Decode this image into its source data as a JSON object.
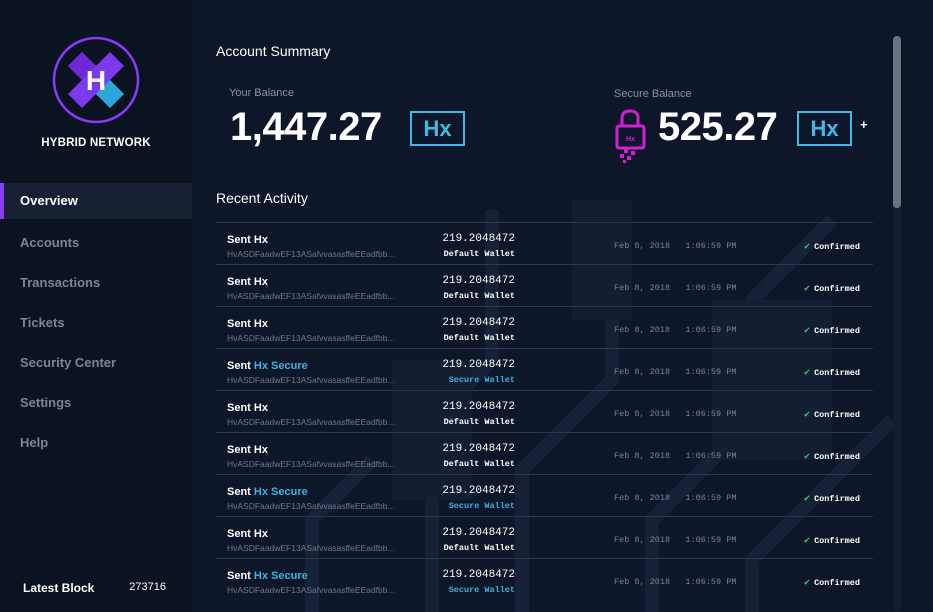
{
  "brand": {
    "name": "HYBRID NETWORK",
    "logo_letter": "H"
  },
  "sidebar": {
    "items": [
      {
        "label": "Overview",
        "active": true
      },
      {
        "label": "Accounts",
        "active": false
      },
      {
        "label": "Transactions",
        "active": false
      },
      {
        "label": "Tickets",
        "active": false
      },
      {
        "label": "Security Center",
        "active": false
      },
      {
        "label": "Settings",
        "active": false
      },
      {
        "label": "Help",
        "active": false
      }
    ],
    "latest_block_label": "Latest Block",
    "latest_block_value": "273716"
  },
  "summary": {
    "title": "Account Summary",
    "your_balance_label": "Your Balance",
    "your_balance_value": "1,447.27",
    "currency": "Hx",
    "secure_balance_label": "Secure Balance",
    "secure_balance_value": "525.27",
    "plus": "+"
  },
  "activity": {
    "title": "Recent Activity",
    "rows": [
      {
        "prefix": "Sent",
        "asset": "Hx",
        "secure": false,
        "address": "HvASDFaadwEF13ASafvvasasffeEEadfbb...",
        "amount": "219.2048472",
        "wallet": "Default Wallet",
        "date": "Feb 8, 2018   1:06:59 PM",
        "status": "Confirmed"
      },
      {
        "prefix": "Sent",
        "asset": "Hx",
        "secure": false,
        "address": "HvASDFaadwEF13ASafvvasasffeEEadfbb...",
        "amount": "219.2048472",
        "wallet": "Default Wallet",
        "date": "Feb 8, 2018   1:06:59 PM",
        "status": "Confirmed"
      },
      {
        "prefix": "Sent",
        "asset": "Hx",
        "secure": false,
        "address": "HvASDFaadwEF13ASafvvasasffeEEadfbb...",
        "amount": "219.2048472",
        "wallet": "Default Wallet",
        "date": "Feb 8, 2018   1:06:59 PM",
        "status": "Confirmed"
      },
      {
        "prefix": "Sent",
        "asset": "Hx Secure",
        "secure": true,
        "address": "HvASDFaadwEF13ASafvvasasffeEEadfbb...",
        "amount": "219.2048472",
        "wallet": "Secure Wallet",
        "date": "Feb 8, 2018   1:06:59 PM",
        "status": "Confirmed"
      },
      {
        "prefix": "Sent",
        "asset": "Hx",
        "secure": false,
        "address": "HvASDFaadwEF13ASafvvasasffeEEadfbb...",
        "amount": "219.2048472",
        "wallet": "Default Wallet",
        "date": "Feb 8, 2018   1:06:59 PM",
        "status": "Confirmed"
      },
      {
        "prefix": "Sent",
        "asset": "Hx",
        "secure": false,
        "address": "HvASDFaadwEF13ASafvvasasffeEEadfbb...",
        "amount": "219.2048472",
        "wallet": "Default Wallet",
        "date": "Feb 8, 2018   1:06:59 PM",
        "status": "Confirmed"
      },
      {
        "prefix": "Sent",
        "asset": "Hx Secure",
        "secure": true,
        "address": "HvASDFaadwEF13ASafvvasasffeEEadfbb...",
        "amount": "219.2048472",
        "wallet": "Secure Wallet",
        "date": "Feb 8, 2018   1:06:59 PM",
        "status": "Confirmed"
      },
      {
        "prefix": "Sent",
        "asset": "Hx",
        "secure": false,
        "address": "HvASDFaadwEF13ASafvvasasffeEEadfbb...",
        "amount": "219.2048472",
        "wallet": "Default Wallet",
        "date": "Feb 8, 2018   1:06:59 PM",
        "status": "Confirmed"
      },
      {
        "prefix": "Sent",
        "asset": "Hx Secure",
        "secure": true,
        "address": "HvASDFaadwEF13ASafvvasasffeEEadfbb...",
        "amount": "219.2048472",
        "wallet": "Secure Wallet",
        "date": "Feb 8, 2018   1:06:59 PM",
        "status": "Confirmed"
      }
    ]
  },
  "icons": {
    "logo": "hybrid-x-logo-icon",
    "lock": "pixel-lock-icon",
    "check": "check-icon"
  },
  "colors": {
    "accent_purple": "#8b3cf6",
    "accent_blue": "#45b8e8",
    "secure_blue": "#3db2e0",
    "confirmed_green": "#3bbf6a",
    "lock_magenta": "#d21fd6"
  }
}
